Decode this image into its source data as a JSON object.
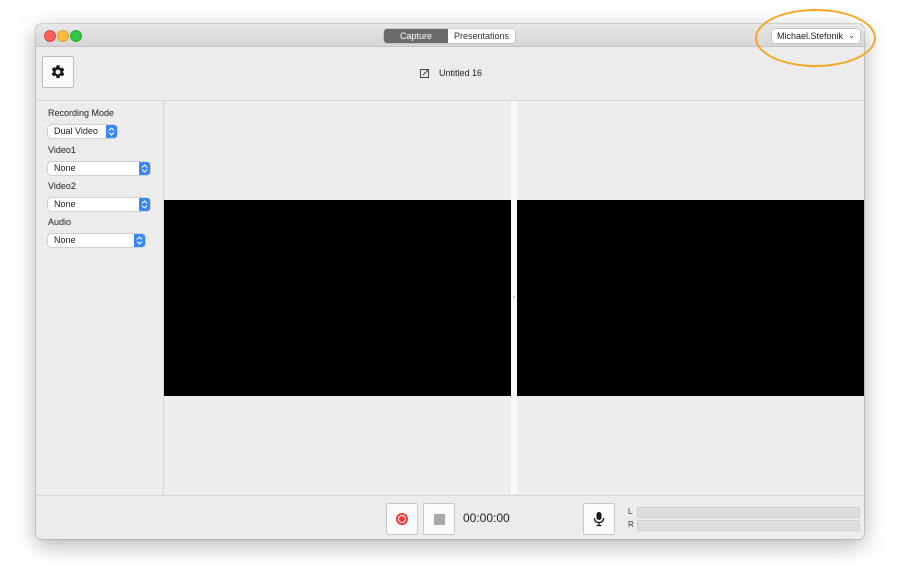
{
  "titlebar": {
    "tabs": [
      {
        "label": "Capture",
        "active": true
      },
      {
        "label": "Presentations",
        "active": false
      }
    ],
    "user_menu": {
      "value": "Michael.Stefonik",
      "icon": "chevron-down-icon"
    }
  },
  "toolbar": {
    "settings_icon": "gear-icon",
    "document_title": "Untitled 16",
    "edit_icon": "edit-square-icon"
  },
  "sidebar": {
    "recording_mode": {
      "label": "Recording Mode",
      "value": "Dual Video"
    },
    "video1": {
      "label": "Video1",
      "value": "None"
    },
    "video2": {
      "label": "Video2",
      "value": "None"
    },
    "audio": {
      "label": "Audio",
      "value": "None"
    }
  },
  "controls": {
    "record_icon": "record-icon",
    "stop_icon": "stop-icon",
    "elapsed_time": "00:00:00",
    "mic_icon": "microphone-icon",
    "level_left_label": "L",
    "level_right_label": "R"
  },
  "colors": {
    "record_red": "#f0393a",
    "popup_blue": "#3b87f6",
    "highlight_orange": "#f5a623",
    "video_black": "#000000"
  }
}
